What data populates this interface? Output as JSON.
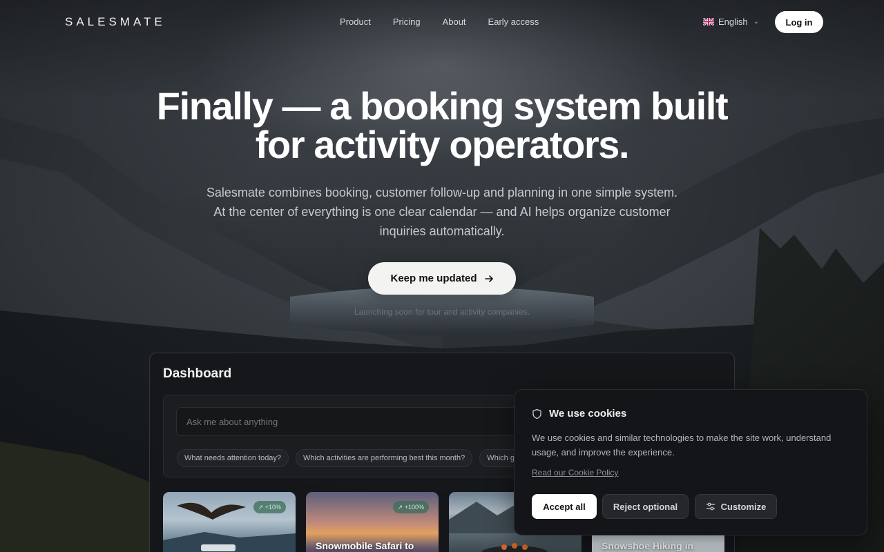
{
  "brand": {
    "logo_text": "SALESMATE"
  },
  "nav": {
    "links": [
      "Product",
      "Pricing",
      "About",
      "Early access"
    ],
    "language": "English",
    "login_label": "Log in"
  },
  "hero": {
    "title_line1": "Finally — a booking system built",
    "title_line2": "for activity operators.",
    "subtitle": "Salesmate combines booking, customer follow-up and planning in one simple system. At the center of everything is one clear calendar — and AI helps organize customer inquiries automatically.",
    "cta_label": "Keep me updated",
    "launch_note": "Launching soon for tour and activity companies."
  },
  "dashboard": {
    "title": "Dashboard",
    "ask_placeholder": "Ask me about anything",
    "chips": [
      "What needs attention today?",
      "Which activities are performing best this month?",
      "Which g"
    ],
    "cards": [
      {
        "badge": "+10%",
        "caption": ""
      },
      {
        "badge": "+100%",
        "caption": "Snowmobile Safari to"
      },
      {
        "badge": "",
        "caption": ""
      },
      {
        "badge": "",
        "caption": "Snowshoe Hiking in"
      }
    ]
  },
  "cookie": {
    "title": "We use cookies",
    "text": "We use cookies and similar technologies to make the site work, understand usage, and improve the experience.",
    "link": "Read our Cookie Policy",
    "accept_label": "Accept all",
    "reject_label": "Reject optional",
    "customize_label": "Customize"
  },
  "icons": {
    "flag": "uk-flag-icon",
    "language_chevron": "chevron-down-icon",
    "cta_arrow": "arrow-right-icon",
    "cookie_shield": "shield-icon",
    "customize": "sliders-icon",
    "trend": "trend-up-icon"
  }
}
